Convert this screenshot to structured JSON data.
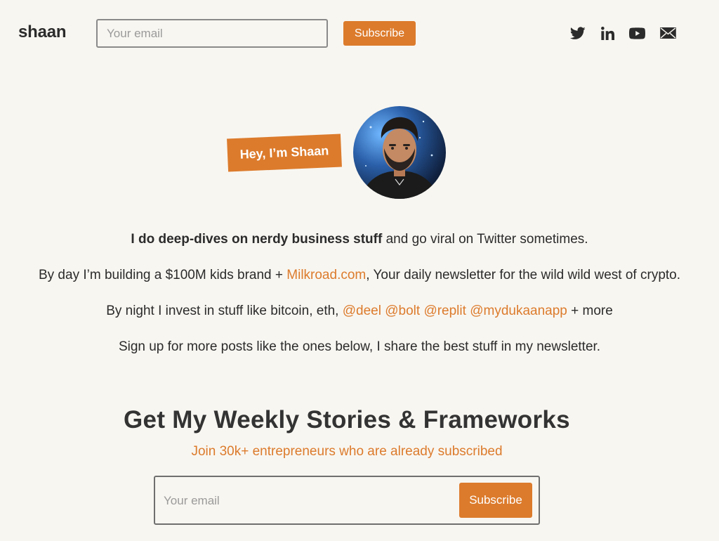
{
  "header": {
    "brand": "shaan",
    "email_placeholder": "Your email",
    "subscribe_label": "Subscribe",
    "social": [
      "twitter-icon",
      "linkedin-icon",
      "youtube-icon",
      "mail-icon"
    ]
  },
  "hero": {
    "greeting": "Hey, I’m Shaan"
  },
  "bio": {
    "line1_bold": "I do deep-dives on nerdy business stuff",
    "line1_rest": " and go viral on Twitter sometimes.",
    "line2_pre": "By day I’m building a $100M kids brand + ",
    "line2_link": "Milkroad.com",
    "line2_post": ", Your daily newsletter for the wild wild west of crypto.",
    "line3_pre": "By night I invest in stuff like bitcoin, eth, ",
    "line3_links": [
      "@deel",
      "@bolt",
      "@replit",
      "@mydukaanapp"
    ],
    "line3_post": " + more",
    "line4": "Sign up for more posts like the ones below, I share the best stuff in my newsletter."
  },
  "signup": {
    "title": "Get My Weekly Stories & Frameworks",
    "subtitle": "Join 30k+ entrepreneurs who are already subscribed",
    "email_placeholder": "Your email",
    "subscribe_label": "Subscribe"
  },
  "colors": {
    "accent": "#dc7b2c",
    "background": "#f8f6f1",
    "text": "#2b2b2b"
  }
}
